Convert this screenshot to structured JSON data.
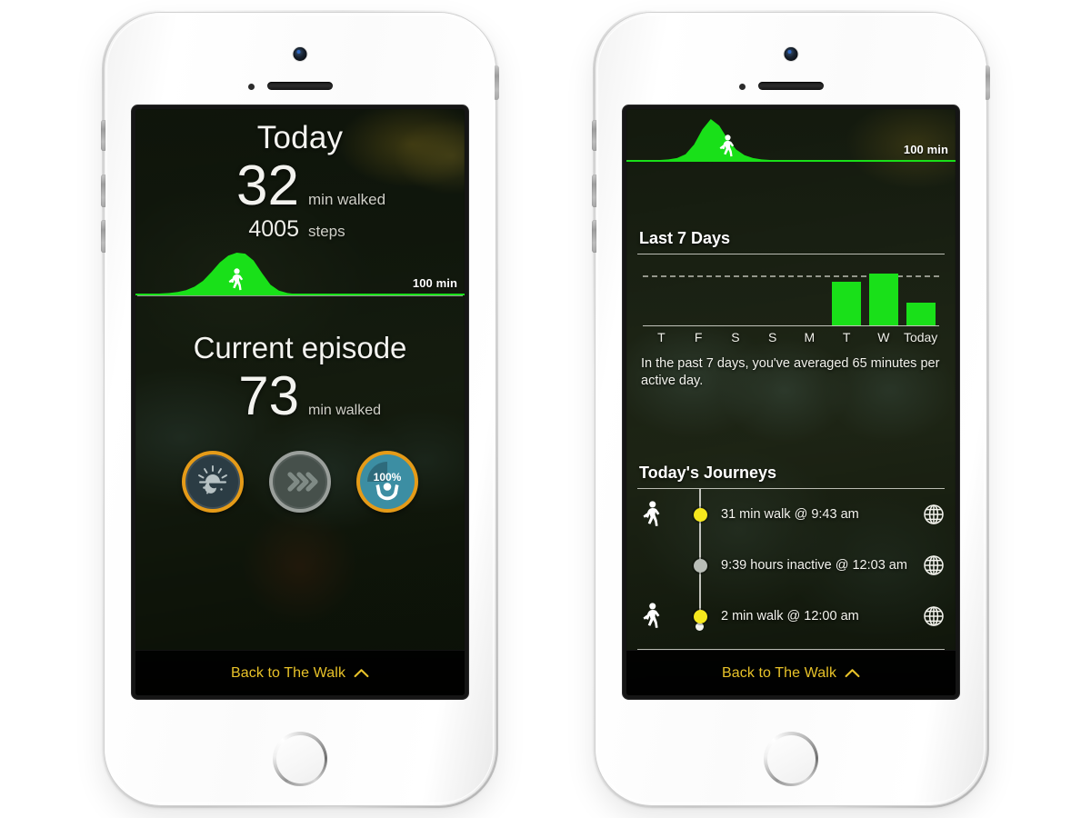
{
  "left_phone": {
    "name": "today-screen",
    "sparkline": {
      "min_label": "100 min",
      "walker_icon": "walker-icon",
      "peak_position_pct": 30,
      "series": [
        0,
        0,
        1,
        2,
        3,
        5,
        9,
        16,
        28,
        46,
        66,
        80,
        86,
        84,
        70,
        44,
        20,
        8,
        3,
        1,
        0,
        0,
        0,
        0,
        0,
        0,
        0,
        0,
        0,
        0,
        0,
        0,
        0,
        0,
        0,
        0,
        0,
        0,
        0,
        0
      ]
    },
    "today": {
      "title": "Today",
      "minutes_value": "32",
      "minutes_unit": "min walked",
      "steps_value": "4005",
      "steps_unit": "steps"
    },
    "episode": {
      "title": "Current episode",
      "minutes_value": "73",
      "minutes_unit": "min walked"
    },
    "badges": [
      {
        "name": "day-night-badge",
        "icon": "sun-moon-icon",
        "ring_color": "#e59b18",
        "fill_color": "#2b3c44",
        "label": ""
      },
      {
        "name": "speed-badge",
        "icon": "triple-chevron-icon",
        "ring_color": "#9a9f9b",
        "fill_color": "#46504b",
        "label": ""
      },
      {
        "name": "goal-badge",
        "icon": "celebrate-person-icon",
        "ring_color": "#e59b18",
        "fill_color": "#3c8ea3",
        "label": "100%"
      }
    ],
    "footer": {
      "label": "Back to The Walk",
      "chevron_icon": "chevron-up-icon"
    }
  },
  "right_phone": {
    "name": "stats-screen",
    "sparkline": {
      "min_label": "100 min",
      "walker_icon": "walker-icon",
      "series": [
        0,
        0,
        0,
        1,
        2,
        3,
        6,
        14,
        34,
        66,
        88,
        74,
        46,
        24,
        12,
        6,
        3,
        2,
        1,
        1,
        0,
        0,
        0,
        0,
        0,
        0,
        0,
        0,
        0,
        0,
        0,
        0,
        0,
        0,
        0,
        0,
        0,
        0,
        0,
        0
      ]
    },
    "last7": {
      "heading": "Last 7 Days",
      "summary": "In the past 7 days, you've averaged 65 minutes per active day."
    },
    "journeys": {
      "heading": "Today's Journeys",
      "items": [
        {
          "walker": true,
          "dot": "active",
          "text": "31 min walk @ 9:43 am",
          "globe_icon": "globe-icon"
        },
        {
          "walker": false,
          "dot": "inactive",
          "text": "9:39 hours inactive @ 12:03 am",
          "globe_icon": "globe-icon"
        },
        {
          "walker": true,
          "dot": "active",
          "text": "2 min walk @ 12:00 am",
          "globe_icon": "globe-icon"
        }
      ]
    },
    "footer": {
      "label": "Back to The Walk",
      "chevron_icon": "chevron-up-icon"
    }
  },
  "chart_data": {
    "type": "bar",
    "title": "Last 7 Days",
    "categories": [
      "T",
      "F",
      "S",
      "S",
      "M",
      "T",
      "W",
      "Today"
    ],
    "values": [
      0,
      0,
      0,
      0,
      0,
      78,
      92,
      40
    ],
    "units": "minutes walked",
    "ylim": [
      0,
      100
    ],
    "average_line": 88,
    "average_line_style": "dashed",
    "bar_color": "#19e019",
    "axis_color": "#ebebe4",
    "grid": false,
    "legend": "none",
    "xlabel": "",
    "ylabel": "",
    "annotation": "In the past 7 days, you've averaged 65 minutes per active day."
  }
}
